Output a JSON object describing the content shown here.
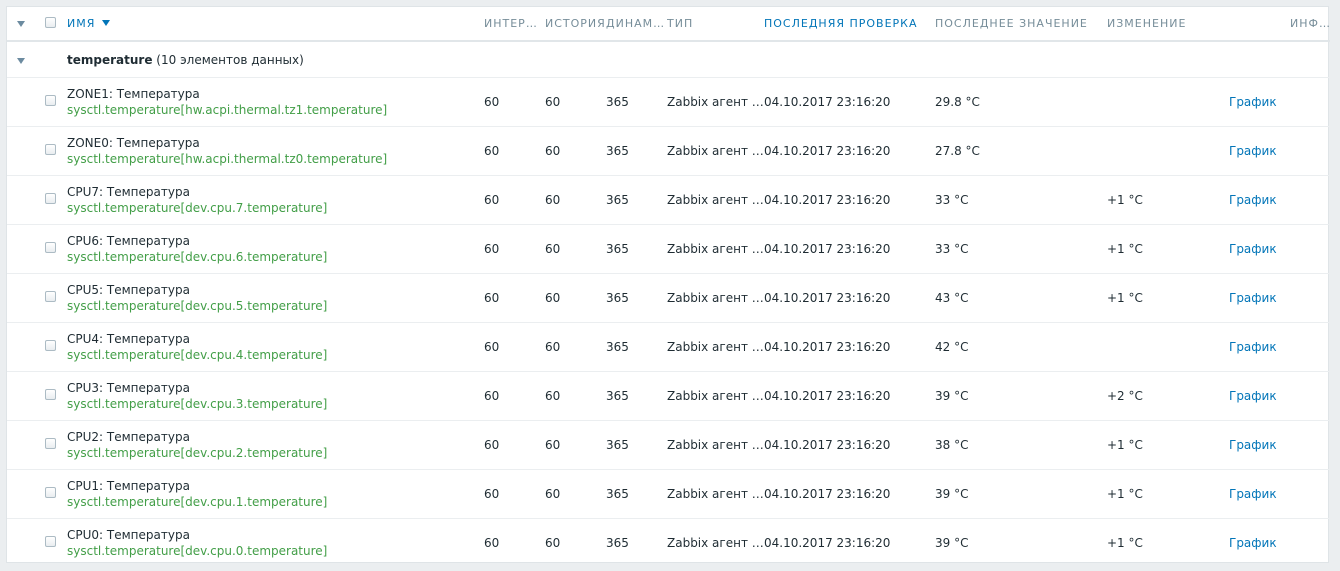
{
  "columns": {
    "name": "Имя",
    "interval": "Интервал",
    "history": "История",
    "trends": "Динамика",
    "type": "Тип",
    "last_check": "Последняя проверка",
    "last_value": "Последнее значение",
    "change": "Изменение",
    "info": "Информация"
  },
  "group": {
    "name": "temperature",
    "count": "(10 элементов данных)"
  },
  "items": [
    {
      "name": "ZONE1: Температура",
      "key": "sysctl.temperature[hw.acpi.thermal.tz1.temperature]",
      "interval": "60",
      "history": "60",
      "trends": "365",
      "type": "Zabbix агент (активный)",
      "last_check": "04.10.2017 23:16:20",
      "last_value": "29.8 °C",
      "change": "",
      "action": "График"
    },
    {
      "name": "ZONE0: Температура",
      "key": "sysctl.temperature[hw.acpi.thermal.tz0.temperature]",
      "interval": "60",
      "history": "60",
      "trends": "365",
      "type": "Zabbix агент (активный)",
      "last_check": "04.10.2017 23:16:20",
      "last_value": "27.8 °C",
      "change": "",
      "action": "График"
    },
    {
      "name": "CPU7: Температура",
      "key": "sysctl.temperature[dev.cpu.7.temperature]",
      "interval": "60",
      "history": "60",
      "trends": "365",
      "type": "Zabbix агент (активный)",
      "last_check": "04.10.2017 23:16:20",
      "last_value": "33 °C",
      "change": "+1 °C",
      "action": "График"
    },
    {
      "name": "CPU6: Температура",
      "key": "sysctl.temperature[dev.cpu.6.temperature]",
      "interval": "60",
      "history": "60",
      "trends": "365",
      "type": "Zabbix агент (активный)",
      "last_check": "04.10.2017 23:16:20",
      "last_value": "33 °C",
      "change": "+1 °C",
      "action": "График"
    },
    {
      "name": "CPU5: Температура",
      "key": "sysctl.temperature[dev.cpu.5.temperature]",
      "interval": "60",
      "history": "60",
      "trends": "365",
      "type": "Zabbix агент (активный)",
      "last_check": "04.10.2017 23:16:20",
      "last_value": "43 °C",
      "change": "+1 °C",
      "action": "График"
    },
    {
      "name": "CPU4: Температура",
      "key": "sysctl.temperature[dev.cpu.4.temperature]",
      "interval": "60",
      "history": "60",
      "trends": "365",
      "type": "Zabbix агент (активный)",
      "last_check": "04.10.2017 23:16:20",
      "last_value": "42 °C",
      "change": "",
      "action": "График"
    },
    {
      "name": "CPU3: Температура",
      "key": "sysctl.temperature[dev.cpu.3.temperature]",
      "interval": "60",
      "history": "60",
      "trends": "365",
      "type": "Zabbix агент (активный)",
      "last_check": "04.10.2017 23:16:20",
      "last_value": "39 °C",
      "change": "+2 °C",
      "action": "График"
    },
    {
      "name": "CPU2: Температура",
      "key": "sysctl.temperature[dev.cpu.2.temperature]",
      "interval": "60",
      "history": "60",
      "trends": "365",
      "type": "Zabbix агент (активный)",
      "last_check": "04.10.2017 23:16:20",
      "last_value": "38 °C",
      "change": "+1 °C",
      "action": "График"
    },
    {
      "name": "CPU1: Температура",
      "key": "sysctl.temperature[dev.cpu.1.temperature]",
      "interval": "60",
      "history": "60",
      "trends": "365",
      "type": "Zabbix агент (активный)",
      "last_check": "04.10.2017 23:16:20",
      "last_value": "39 °C",
      "change": "+1 °C",
      "action": "График"
    },
    {
      "name": "CPU0: Температура",
      "key": "sysctl.temperature[dev.cpu.0.temperature]",
      "interval": "60",
      "history": "60",
      "trends": "365",
      "type": "Zabbix агент (активный)",
      "last_check": "04.10.2017 23:16:20",
      "last_value": "39 °C",
      "change": "+1 °C",
      "action": "График"
    }
  ]
}
